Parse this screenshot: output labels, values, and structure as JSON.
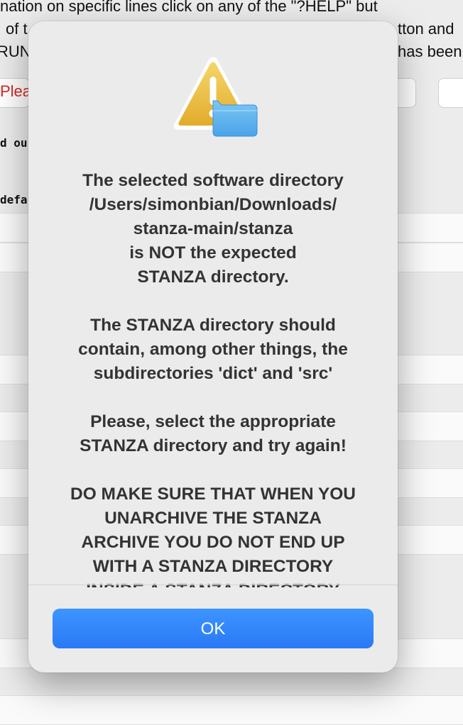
{
  "background": {
    "line1": "nation on specific lines click on any of the \"?HELP\" but",
    "line2_left": "of t",
    "line2_right": "tton and",
    "line3_left": "RUN",
    "line3_right": "has been",
    "red_text": "Pleas",
    "mono1": "d ou",
    "mono2": "defa"
  },
  "dialog": {
    "icon": "warning-folder-icon",
    "paragraphs": [
      "The selected software directory\n/Users/simonbian/Downloads/\nstanza-main/stanza\nis NOT the expected\nSTANZA directory.",
      "The STANZA directory should\ncontain, among other things, the\nsubdirectories 'dict' and 'src'",
      "Please, select the appropriate\nSTANZA directory and try again!",
      "DO MAKE SURE THAT WHEN YOU\nUNARCHIVE THE STANZA\nARCHIVE YOU DO NOT END UP\nWITH A STANZA DIRECTORY\nINSIDE A STANZA DIRECTORY"
    ],
    "ok_label": "OK"
  },
  "colors": {
    "accent": "#2a79f5",
    "warning": "#e8b73a",
    "folder": "#5cb2ef"
  }
}
